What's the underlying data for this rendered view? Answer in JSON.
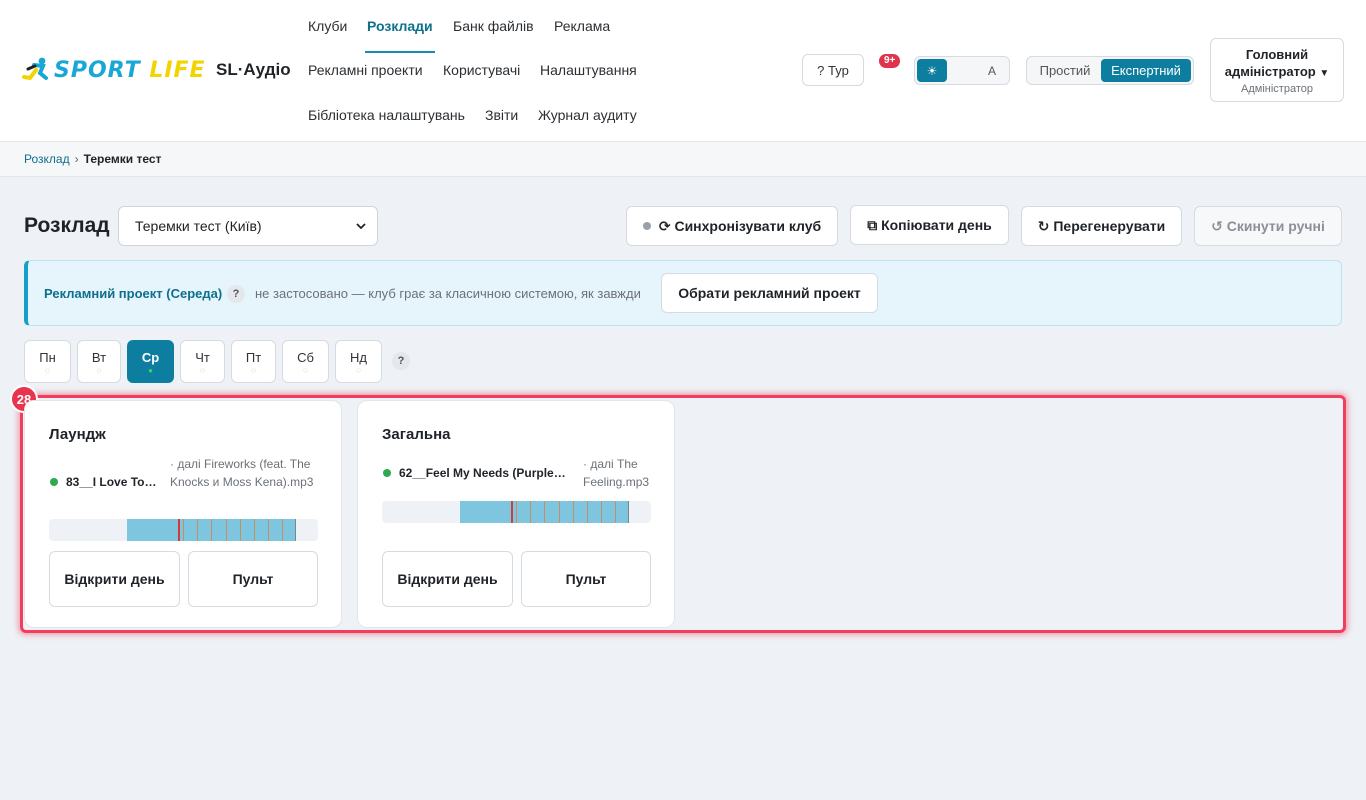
{
  "header": {
    "brand": {
      "logo_text_a": "SPORT",
      "logo_text_b": "LIFE",
      "app_name": "SL·Аудіо"
    },
    "nav": [
      {
        "label": "Клуби",
        "active": false
      },
      {
        "label": "Розклади",
        "active": true
      },
      {
        "label": "Банк файлів",
        "active": false
      },
      {
        "label": "Реклама",
        "active": false
      },
      {
        "label": "Рекламні проекти",
        "active": false
      },
      {
        "label": "Користувачі",
        "active": false
      },
      {
        "label": "Налаштування",
        "active": false
      },
      {
        "label": "Бібліотека налаштувань",
        "active": false
      },
      {
        "label": "Звіти",
        "active": false
      },
      {
        "label": "Журнал аудиту",
        "active": false
      }
    ],
    "icon_glyph": "",
    "tour_label": "? Тур",
    "notifications_badge": "9+",
    "theme_options": [
      {
        "icon": "sun-icon",
        "glyph": "☀",
        "active": true
      },
      {
        "icon": "moon-icon",
        "glyph": "",
        "active": false
      },
      {
        "icon": "auto-icon",
        "glyph": "A",
        "active": false
      }
    ],
    "mode_options": [
      {
        "label": "Простий",
        "active": false
      },
      {
        "label": "Експертний",
        "active": true
      }
    ],
    "user": {
      "name_line1": "Головний",
      "name_line2": "адміністратор",
      "caret": "▼",
      "role": "Адміністратор"
    }
  },
  "breadcrumb": {
    "link": "Розклад",
    "sep": "›",
    "current": "Теремки тест"
  },
  "toolbar": {
    "title": "Розклад",
    "club_selected": "Теремки тест (Київ)",
    "sync_label": "⟳ Синхронізувати клуб",
    "copy_label": "⧉ Копіювати день",
    "regenerate_label": "↻ Перегенерувати",
    "reset_label": "↺ Скинути ручні"
  },
  "ad_banner": {
    "label": "Рекламний проект (Середа)",
    "help": "?",
    "note": "не застосовано — клуб грає за класичною системою, як завжди",
    "button": "Обрати рекламний проект"
  },
  "days": [
    {
      "label": "Пн",
      "dot": "◌",
      "active": false
    },
    {
      "label": "Вт",
      "dot": "◌",
      "active": false
    },
    {
      "label": "Ср",
      "dot": "●",
      "active": true
    },
    {
      "label": "Чт",
      "dot": "◌",
      "active": false
    },
    {
      "label": "Пт",
      "dot": "◌",
      "active": false
    },
    {
      "label": "Сб",
      "dot": "◌",
      "active": false
    },
    {
      "label": "Нд",
      "dot": "◌",
      "active": false
    }
  ],
  "days_help": "?",
  "highlight_badge": "28",
  "zones": [
    {
      "title": "Лаундж",
      "now_playing": "83__I Love To…",
      "next": "· далі Fireworks (feat. The Knocks и Moss Kena).mp3",
      "open_day": "Відкрити день",
      "console": " Пульт"
    },
    {
      "title": "Загальна",
      "now_playing": "62__Feel My Needs (Purple…",
      "next": "· далі The Feeling.mp3",
      "open_day": "Відкрити день",
      "console": " Пульт"
    }
  ],
  "colors": {
    "accent": "#0e7ea0",
    "highlight": "#f03e5c",
    "playing": "#2fa84f"
  }
}
